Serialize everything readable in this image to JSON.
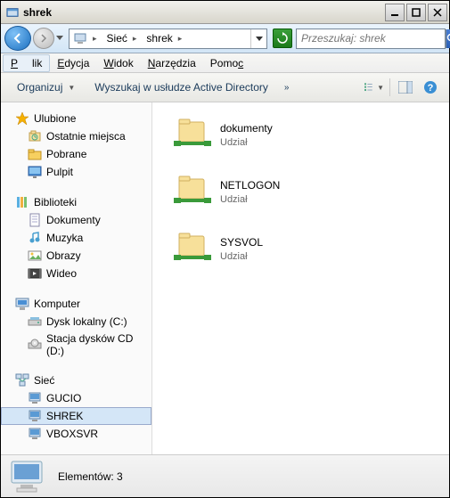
{
  "window": {
    "title": "shrek"
  },
  "address": {
    "seg1": "Sieć",
    "seg2": "shrek"
  },
  "search": {
    "placeholder": "Przeszukaj: shrek"
  },
  "menu": {
    "plik": "Plik",
    "edycja": "Edycja",
    "widok": "Widok",
    "narzedzia": "Narzędzia",
    "pomoc": "Pomoc"
  },
  "toolbar": {
    "organize": "Organizuj",
    "directory": "Wyszukaj w usłudze Active Directory"
  },
  "nav": {
    "favorites": "Ulubione",
    "fav_items": [
      "Ostatnie miejsca",
      "Pobrane",
      "Pulpit"
    ],
    "libraries": "Biblioteki",
    "lib_items": [
      "Dokumenty",
      "Muzyka",
      "Obrazy",
      "Wideo"
    ],
    "computer": "Komputer",
    "comp_items": [
      "Dysk lokalny (C:)",
      "Stacja dysków CD (D:)"
    ],
    "network": "Sieć",
    "net_items": [
      "GUCIO",
      "SHREK",
      "VBOXSVR"
    ]
  },
  "content": {
    "share_label": "Udział",
    "items": [
      {
        "name": "dokumenty"
      },
      {
        "name": "NETLOGON"
      },
      {
        "name": "SYSVOL"
      }
    ]
  },
  "status": {
    "text": "Elementów: 3"
  }
}
